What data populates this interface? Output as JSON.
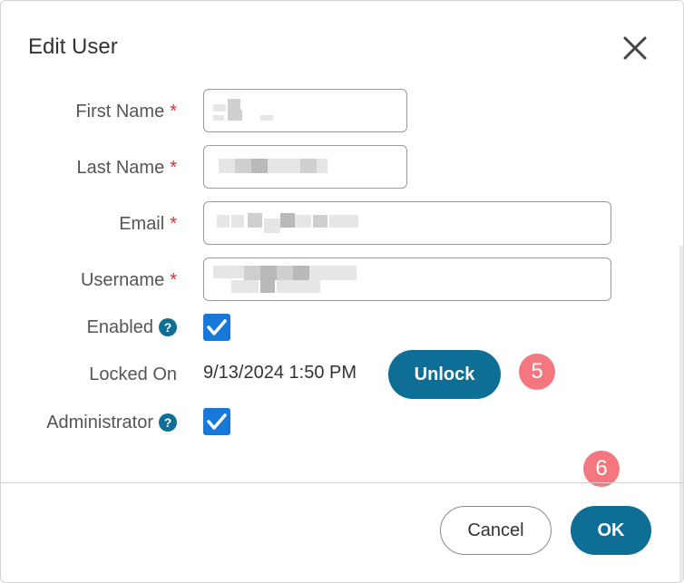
{
  "dialog": {
    "title": "Edit User",
    "close_icon": "close-icon"
  },
  "fields": {
    "first_name": {
      "label": "First Name",
      "required_mark": "*",
      "value": ""
    },
    "last_name": {
      "label": "Last Name",
      "required_mark": "*",
      "value": ""
    },
    "email": {
      "label": "Email",
      "required_mark": "*",
      "value": ""
    },
    "username": {
      "label": "Username",
      "required_mark": "*",
      "value": ""
    },
    "enabled": {
      "label": "Enabled",
      "help_icon": "question-circle-icon",
      "checked": true
    },
    "locked_on": {
      "label": "Locked On",
      "value": "9/13/2024 1:50 PM",
      "unlock_label": "Unlock"
    },
    "administrator": {
      "label": "Administrator",
      "help_icon": "question-circle-icon",
      "checked": true
    }
  },
  "annotations": {
    "marker_unlock": "5",
    "marker_ok": "6"
  },
  "footer": {
    "cancel_label": "Cancel",
    "ok_label": "OK"
  },
  "colors": {
    "primary": "#0f6e96",
    "checkbox": "#1878d9",
    "required": "#d0342c",
    "marker": "#f4777f"
  }
}
